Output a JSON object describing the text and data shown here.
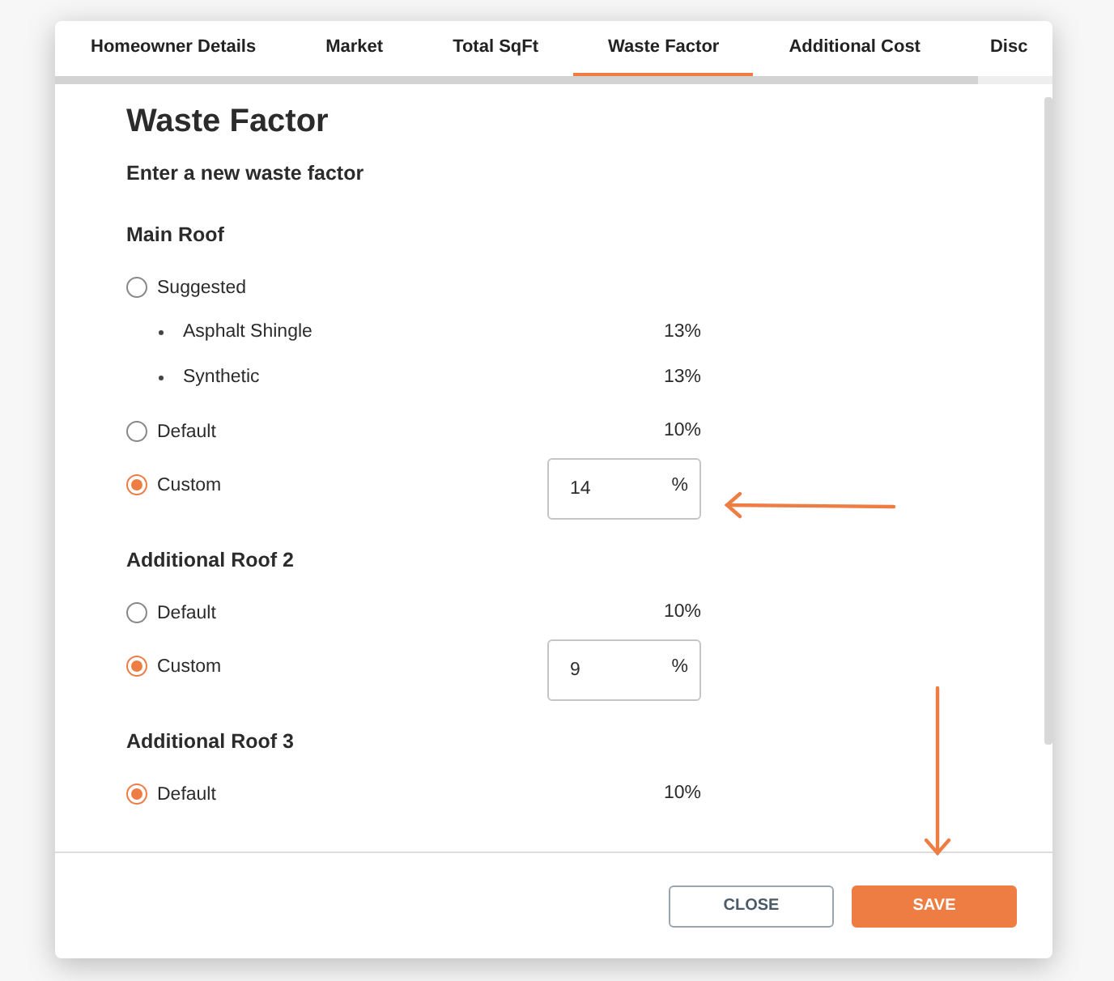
{
  "tabs": [
    {
      "label": "Homeowner Details",
      "selected": false
    },
    {
      "label": "Market",
      "selected": false
    },
    {
      "label": "Total SqFt",
      "selected": false
    },
    {
      "label": "Waste Factor",
      "selected": true
    },
    {
      "label": "Additional Cost",
      "selected": false
    },
    {
      "label": "Disc",
      "selected": false
    }
  ],
  "title": "Waste Factor",
  "subtitle": "Enter a new waste factor",
  "sections": [
    {
      "title": "Main Roof",
      "options": [
        {
          "kind": "radio",
          "label": "Suggested",
          "selected": false
        },
        {
          "kind": "bullet",
          "label": "Asphalt Shingle",
          "value": "13%"
        },
        {
          "kind": "bullet",
          "label": "Synthetic",
          "value": "13%"
        },
        {
          "kind": "radio",
          "label": "Default",
          "selected": false,
          "value": "10%"
        },
        {
          "kind": "radio",
          "label": "Custom",
          "selected": true,
          "input": {
            "value": "14",
            "suffix": "%"
          }
        }
      ]
    },
    {
      "title": "Additional Roof 2",
      "options": [
        {
          "kind": "radio",
          "label": "Default",
          "selected": false,
          "value": "10%"
        },
        {
          "kind": "radio",
          "label": "Custom",
          "selected": true,
          "input": {
            "value": "9",
            "suffix": "%"
          }
        }
      ]
    },
    {
      "title": "Additional Roof 3",
      "options": [
        {
          "kind": "radio",
          "label": "Default",
          "selected": true,
          "value": "10%"
        }
      ]
    }
  ],
  "buttons": [
    {
      "label": "CLOSE",
      "kind": "secondary"
    },
    {
      "label": "SAVE",
      "kind": "primary"
    }
  ]
}
